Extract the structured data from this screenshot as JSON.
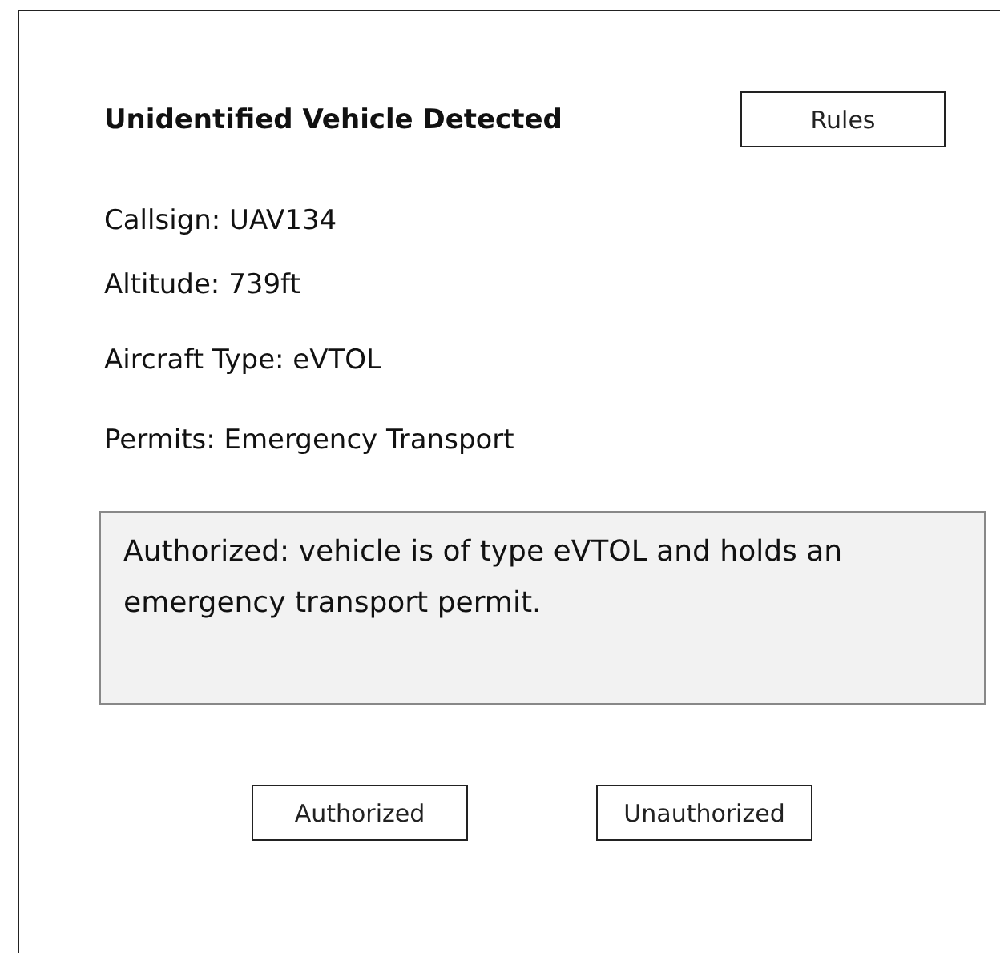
{
  "title": "Unidentified Vehicle Detected",
  "rules_button": "Rules",
  "details": [
    "Callsign: UAV134",
    "Altitude: 739ft",
    "Aircraft Type: eVTOL",
    "Permits: Emergency Transport"
  ],
  "message": "Authorized: vehicle is of type eVTOL and holds an emergency transport permit.",
  "buttons": [
    "Authorized",
    "Unauthorized"
  ]
}
